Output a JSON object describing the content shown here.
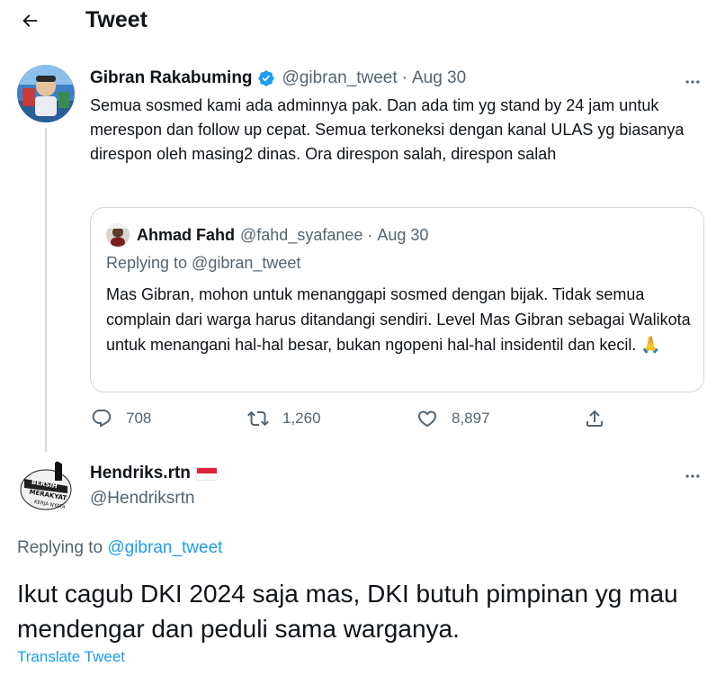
{
  "header": {
    "title": "Tweet",
    "back_icon": "arrow-left-icon"
  },
  "main_tweet": {
    "display_name": "Gibran Rakabuming",
    "handle": "@gibran_tweet",
    "separator": "·",
    "date": "Aug 30",
    "text": "Semua sosmed kami ada adminnya pak. Dan ada tim yg stand by 24 jam untuk merespon dan follow up cepat. Semua terkoneksi dengan kanal ULAS yg biasanya direspon oleh masing2 dinas. Ora direspon salah, direspon salah",
    "quoted": {
      "display_name": "Ahmad Fahd",
      "handle": "@fahd_syafanee",
      "separator": "·",
      "date": "Aug 30",
      "replying_to": "Replying to @gibran_tweet",
      "text": "Mas Gibran, mohon untuk menanggapi sosmed dengan bijak. Tidak semua complain dari warga harus ditandangi sendiri. Level Mas Gibran sebagai Walikota untuk menangani hal-hal besar, bukan ngopeni hal-hal insidentil dan kecil. 🙏"
    },
    "actions": {
      "replies": "708",
      "retweets": "1,260",
      "likes": "8,897"
    }
  },
  "reply_tweet": {
    "display_name": "Hendriks.rtn",
    "handle": "@Hendriksrtn",
    "replying_prefix": "Replying to",
    "replying_mention": "@gibran_tweet",
    "text": "Ikut cagub DKI 2024 saja mas, DKI butuh pimpinan yg mau mendengar dan peduli sama warganya.",
    "translate": "Translate Tweet",
    "avatar_words": [
      "BERSIH",
      "MERAKYAT",
      "KERJA NYATA"
    ]
  },
  "colors": {
    "accent": "#1d9bf0",
    "muted": "#536471",
    "border": "#cfd9de",
    "text": "#0f1419"
  }
}
